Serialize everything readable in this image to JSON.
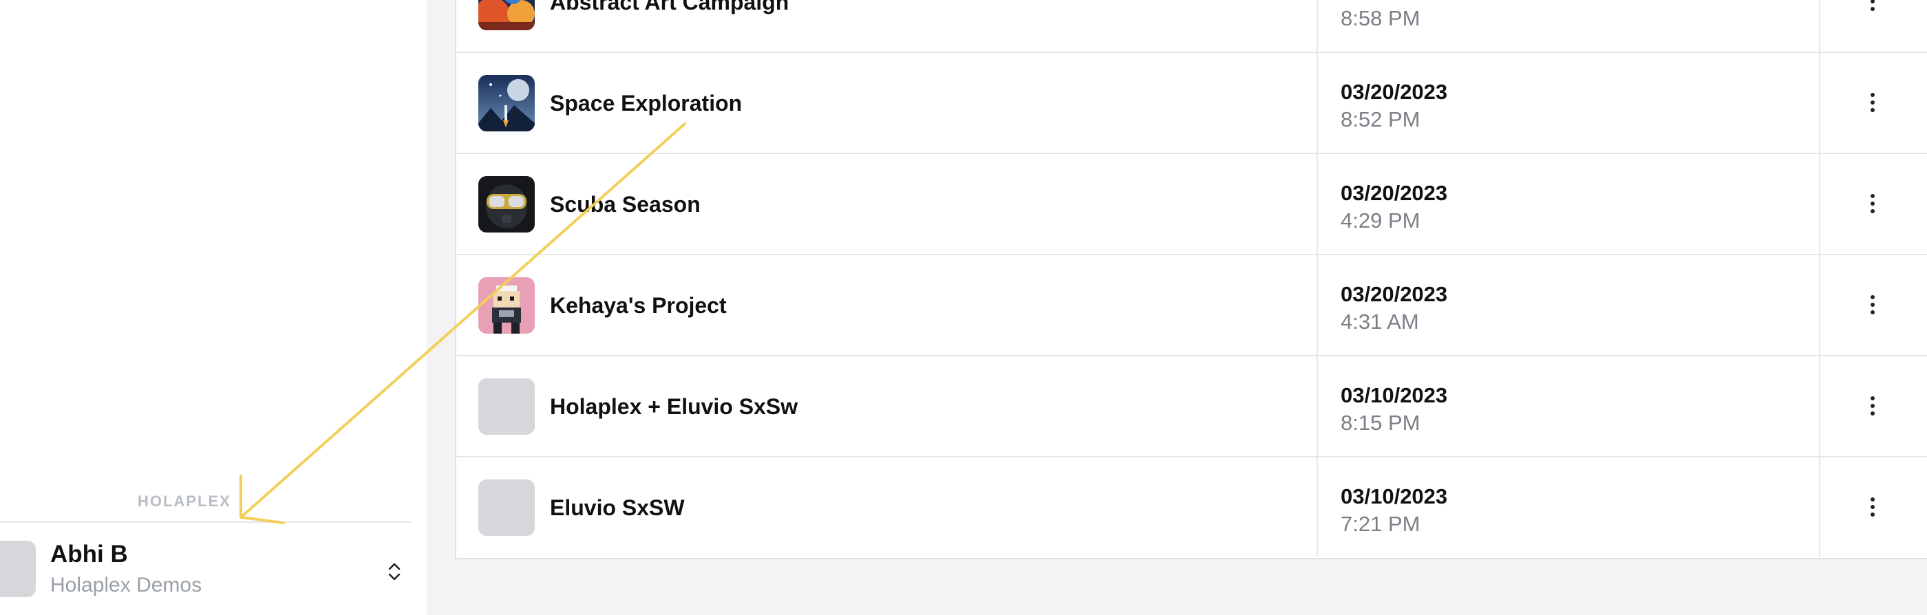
{
  "sidebar": {
    "brand_text": "HOLAPLEX",
    "user": {
      "name": "Abhi B",
      "organization": "Holaplex Demos"
    },
    "switcher_icon": "chevron-up-down-icon"
  },
  "projects": [
    {
      "name": "Abstract Art Campaign",
      "date": "",
      "time": "8:58 PM",
      "thumb": "abstract-art"
    },
    {
      "name": "Space Exploration",
      "date": "03/20/2023",
      "time": "8:52 PM",
      "thumb": "space"
    },
    {
      "name": "Scuba Season",
      "date": "03/20/2023",
      "time": "4:29 PM",
      "thumb": "scuba"
    },
    {
      "name": "Kehaya's Project",
      "date": "03/20/2023",
      "time": "4:31 AM",
      "thumb": "pixel-character"
    },
    {
      "name": "Holaplex + Eluvio SxSw",
      "date": "03/10/2023",
      "time": "8:15 PM",
      "thumb": "placeholder"
    },
    {
      "name": "Eluvio SxSW",
      "date": "03/10/2023",
      "time": "7:21 PM",
      "thumb": "placeholder"
    }
  ],
  "row_menu_icon": "more-vertical-icon",
  "colors": {
    "annotation_arrow": "#f2cf5b",
    "placeholder_thumb": "#d5d7db",
    "page_background": "#f3f3f3"
  }
}
